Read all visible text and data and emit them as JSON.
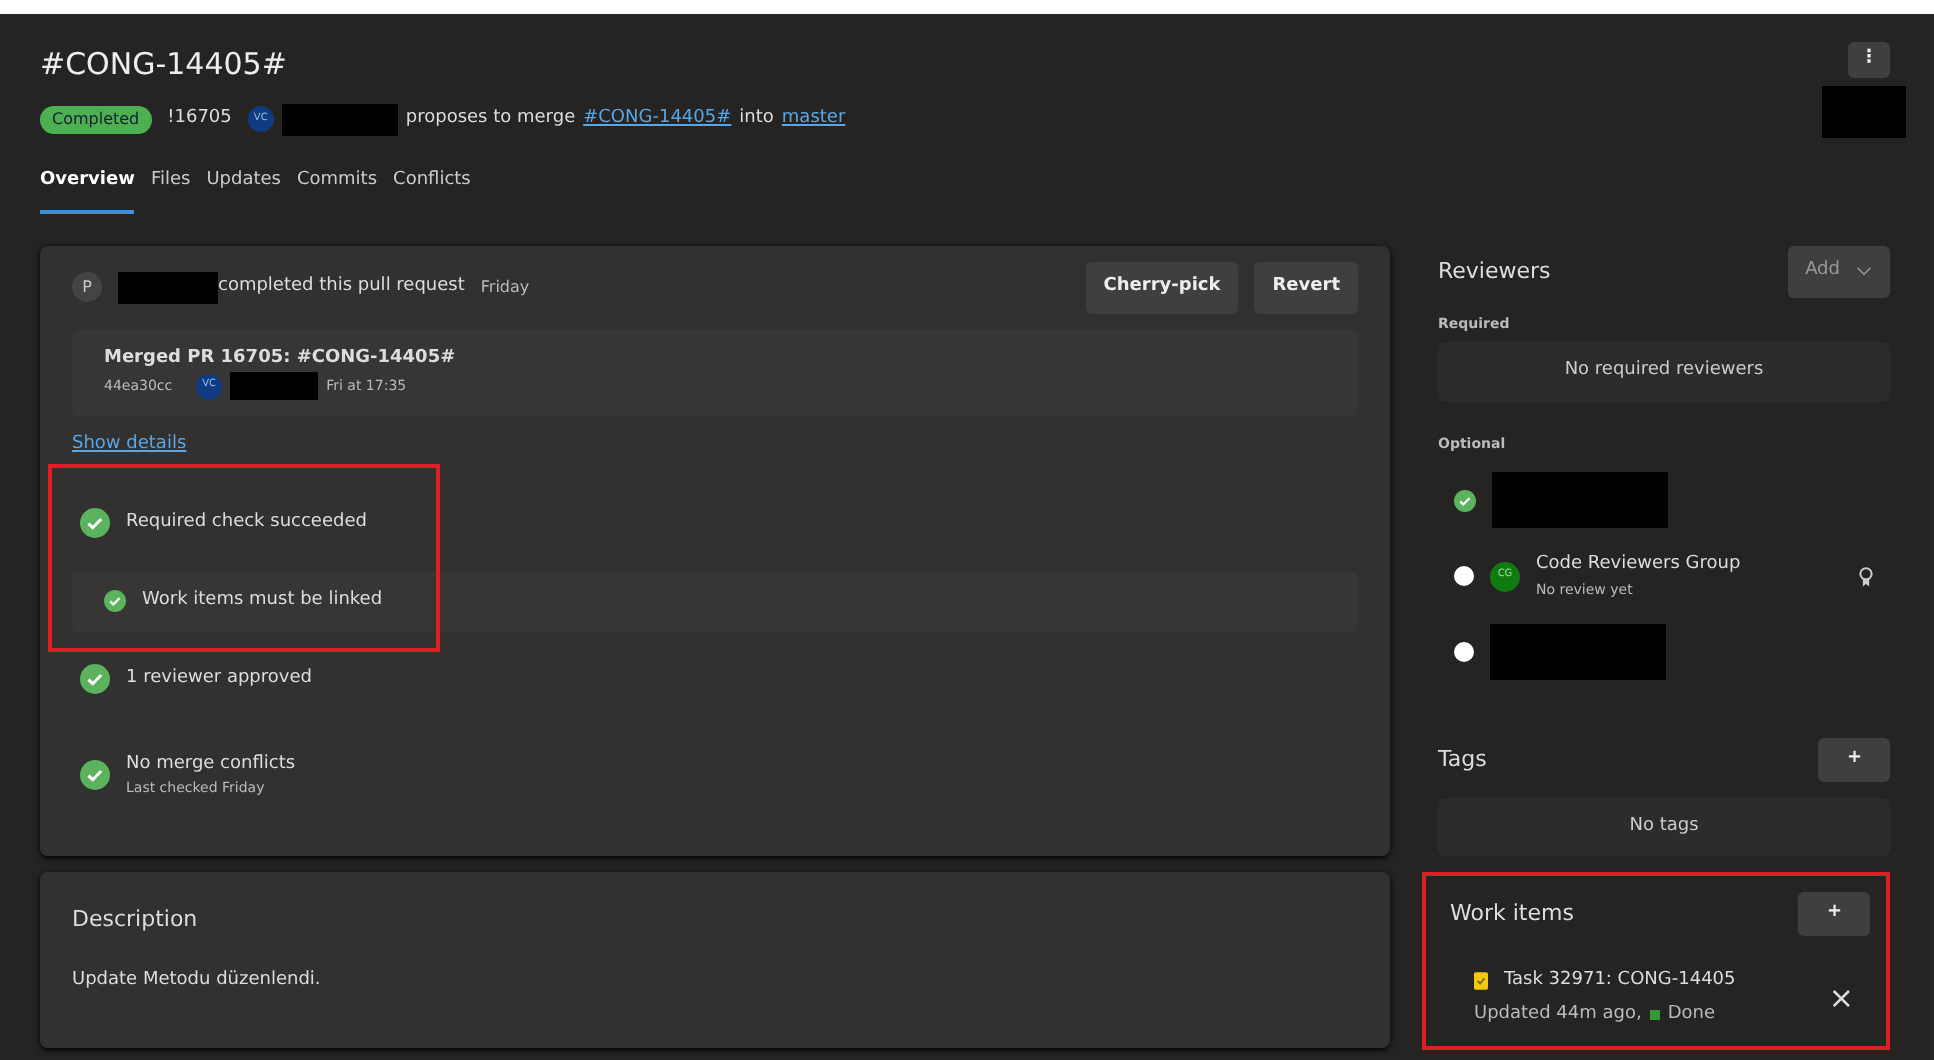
{
  "header": {
    "title": "#CONG-14405#",
    "status": "Completed",
    "pr_id": "!16705",
    "author_avatar": "VC",
    "author_redacted": true,
    "action": "proposes to merge",
    "source_branch": "#CONG-14405#",
    "into": "into",
    "target_branch": "master",
    "more_icon": "⋮",
    "side_redacted": true
  },
  "tabs": [
    {
      "label": "Overview",
      "selected": true
    },
    {
      "label": "Files",
      "selected": false
    },
    {
      "label": "Updates",
      "selected": false
    },
    {
      "label": "Commits",
      "selected": false
    },
    {
      "label": "Conflicts",
      "selected": false
    }
  ],
  "completion": {
    "avatar": "P",
    "author_redacted": true,
    "text": "completed this pull request",
    "when": "Friday",
    "buttons": [
      "Cherry-pick",
      "Revert"
    ],
    "commit": {
      "title": "Merged PR 16705: #CONG-14405#",
      "hash": "44ea30cc",
      "avatar": "VC",
      "author_redacted": true,
      "time": "Fri at 17:35"
    },
    "details_link": "Show details"
  },
  "checks": [
    {
      "kind": "policy",
      "label": "Required check succeeded",
      "highlighted": true
    },
    {
      "kind": "sub",
      "label": "Work items must be linked",
      "highlighted": true
    },
    {
      "kind": "policy",
      "label": "1 reviewer approved",
      "highlighted": false
    },
    {
      "kind": "policy",
      "label": "No merge conflicts",
      "detail": "Last checked Friday",
      "highlighted": false
    }
  ],
  "description": {
    "heading": "Description",
    "text": "Update Metodu düzenlendi."
  },
  "reviewers": {
    "heading": "Reviewers",
    "add_button": "Add",
    "required_label": "Required",
    "required_empty": "No required reviewers",
    "optional_label": "Optional",
    "optional": [
      {
        "kind": "user",
        "approved": true,
        "redacted": true
      },
      {
        "kind": "group",
        "approved": false,
        "avatar": "CG",
        "name": "Code Reviewers Group",
        "status": "No review yet"
      },
      {
        "kind": "user",
        "approved": false,
        "redacted": true
      }
    ]
  },
  "tags": {
    "heading": "Tags",
    "add_button": "+",
    "empty": "No tags"
  },
  "work_items": {
    "heading": "Work items",
    "add_button": "+",
    "highlighted": true,
    "items": [
      {
        "title": "Task 32971: CONG-14405",
        "updated": "Updated 44m ago,",
        "state": "Done",
        "color": "#339933",
        "remove": "×"
      }
    ]
  }
}
